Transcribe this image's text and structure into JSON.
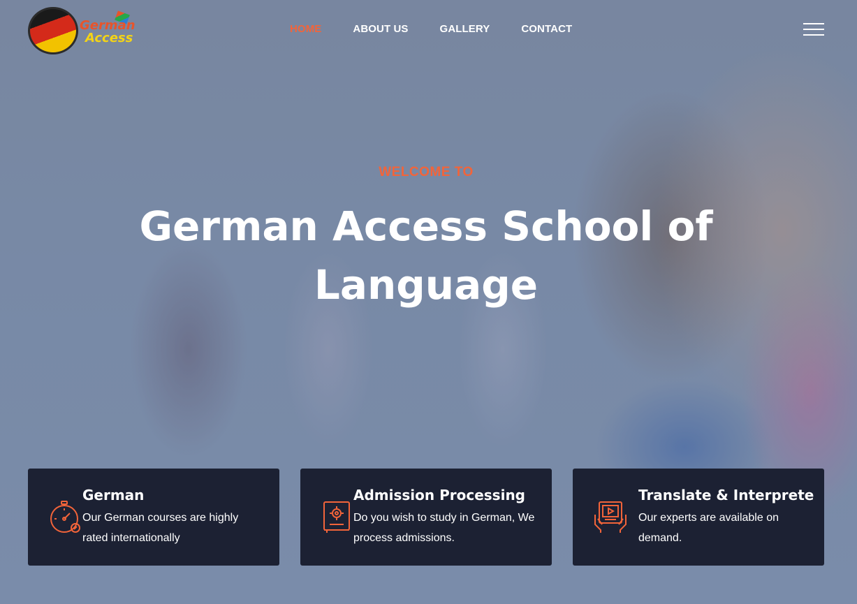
{
  "brand": {
    "logo_line1": "German",
    "logo_line2": "Access",
    "accent_color": "#f2643a"
  },
  "nav": {
    "items": [
      {
        "label": "HOME",
        "active": true
      },
      {
        "label": "ABOUT US",
        "active": false
      },
      {
        "label": "GALLERY",
        "active": false
      },
      {
        "label": "CONTACT",
        "active": false
      }
    ],
    "menu_icon": "hamburger-menu-icon"
  },
  "hero": {
    "eyebrow": "WELCOME TO",
    "title": "German Access School of Language"
  },
  "cards": [
    {
      "icon": "stopwatch-icon",
      "title": "German",
      "description": "Our German courses are highly rated internationally"
    },
    {
      "icon": "gear-book-icon",
      "title": "Admission Processing",
      "description": "Do you wish to study in German, We process admissions."
    },
    {
      "icon": "video-tablet-icon",
      "title": "Translate & Interprete",
      "description": "Our experts are available on demand."
    }
  ]
}
